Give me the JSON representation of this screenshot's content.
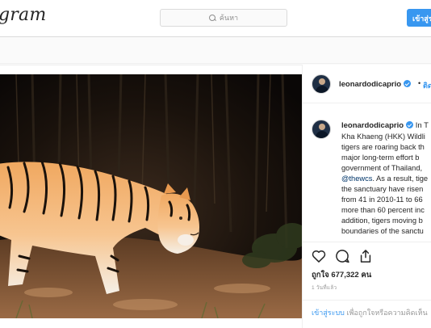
{
  "topbar": {
    "logo_text": "gram",
    "search_placeholder": "ค้นหา",
    "login_button_label": "เข้าสู่ระบบ"
  },
  "post": {
    "username": "leonardodicaprio",
    "follow_label": "ติดตาม",
    "caption_username": "leonardodicaprio",
    "caption_lines": [
      "In T",
      "Kha Khaeng (HKK) Wildli",
      "tigers are roaring back th",
      "major long-term effort b",
      "government of Thailand,",
      "@thewcs",
      ". As a result, tige",
      "the sanctuary have risen",
      "from 41 in 2010-11 to 66",
      "more than 60 percent inc",
      "addition, tigers moving b",
      "boundaries of the sanctu"
    ],
    "likes_prefix": "ถูกใจ",
    "likes_count": "677,322",
    "likes_suffix": "คน",
    "timestamp": "1 วันที่แล้ว",
    "login_prompt_link": "เข้าสู่ระบบ",
    "login_prompt_rest": "เพื่อถูกใจหรือความคิดเห็น",
    "photo_alt": "tiger-photo"
  },
  "colors": {
    "accent": "#3897f0",
    "text": "#262626",
    "muted": "#8e8e8e"
  },
  "icons": [
    "search-icon",
    "verified-badge-icon",
    "heart-icon",
    "comment-icon",
    "share-icon"
  ]
}
